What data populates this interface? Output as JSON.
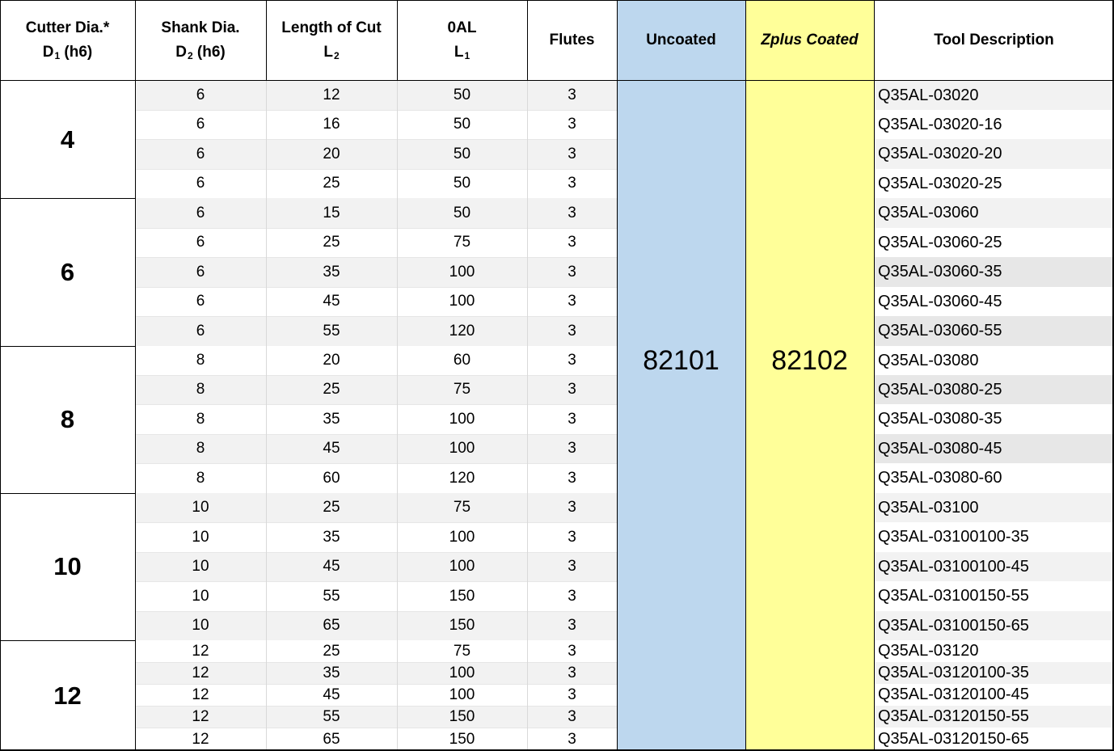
{
  "header": {
    "cutter_line1": "Cutter Dia.*",
    "cutter_line2": "D",
    "cutter_sub": "1",
    "cutter_tail": " (h6)",
    "shank_line1": "Shank Dia.",
    "shank_line2": "D",
    "shank_sub": "2",
    "shank_tail": " (h6)",
    "loc_line1": "Length of Cut",
    "loc_line2": "L",
    "loc_sub": "2",
    "oal_line1": "0AL",
    "oal_line2": "L",
    "oal_sub": "1",
    "flutes": "Flutes",
    "uncoated": "Uncoated",
    "coated": "Zplus Coated",
    "description": "Tool Description"
  },
  "codes": {
    "uncoated": "82101",
    "coated": "82102"
  },
  "colors": {
    "uncoated_bg": "#bdd7ee",
    "coated_bg": "#ffff99",
    "stripe_bg": "#f2f2f2",
    "stripe_desc_bg": "#e7e7e7",
    "grid": "#d9d9d9",
    "border": "#000000"
  },
  "groups": [
    {
      "diameter": "4",
      "rows": [
        {
          "shank": "6",
          "loc": "12",
          "oal": "50",
          "flutes": "3",
          "desc": "Q35AL-03020"
        },
        {
          "shank": "6",
          "loc": "16",
          "oal": "50",
          "flutes": "3",
          "desc": "Q35AL-03020-16"
        },
        {
          "shank": "6",
          "loc": "20",
          "oal": "50",
          "flutes": "3",
          "desc": "Q35AL-03020-20"
        },
        {
          "shank": "6",
          "loc": "25",
          "oal": "50",
          "flutes": "3",
          "desc": "Q35AL-03020-25"
        }
      ]
    },
    {
      "diameter": "6",
      "rows": [
        {
          "shank": "6",
          "loc": "15",
          "oal": "50",
          "flutes": "3",
          "desc": "Q35AL-03060"
        },
        {
          "shank": "6",
          "loc": "25",
          "oal": "75",
          "flutes": "3",
          "desc": "Q35AL-03060-25"
        },
        {
          "shank": "6",
          "loc": "35",
          "oal": "100",
          "flutes": "3",
          "desc": "Q35AL-03060-35"
        },
        {
          "shank": "6",
          "loc": "45",
          "oal": "100",
          "flutes": "3",
          "desc": "Q35AL-03060-45"
        },
        {
          "shank": "6",
          "loc": "55",
          "oal": "120",
          "flutes": "3",
          "desc": "Q35AL-03060-55"
        }
      ]
    },
    {
      "diameter": "8",
      "rows": [
        {
          "shank": "8",
          "loc": "20",
          "oal": "60",
          "flutes": "3",
          "desc": "Q35AL-03080"
        },
        {
          "shank": "8",
          "loc": "25",
          "oal": "75",
          "flutes": "3",
          "desc": "Q35AL-03080-25"
        },
        {
          "shank": "8",
          "loc": "35",
          "oal": "100",
          "flutes": "3",
          "desc": "Q35AL-03080-35"
        },
        {
          "shank": "8",
          "loc": "45",
          "oal": "100",
          "flutes": "3",
          "desc": "Q35AL-03080-45"
        },
        {
          "shank": "8",
          "loc": "60",
          "oal": "120",
          "flutes": "3",
          "desc": "Q35AL-03080-60"
        }
      ]
    },
    {
      "diameter": "10",
      "rows": [
        {
          "shank": "10",
          "loc": "25",
          "oal": "75",
          "flutes": "3",
          "desc": "Q35AL-03100"
        },
        {
          "shank": "10",
          "loc": "35",
          "oal": "100",
          "flutes": "3",
          "desc": "Q35AL-03100100-35"
        },
        {
          "shank": "10",
          "loc": "45",
          "oal": "100",
          "flutes": "3",
          "desc": "Q35AL-03100100-45"
        },
        {
          "shank": "10",
          "loc": "55",
          "oal": "150",
          "flutes": "3",
          "desc": "Q35AL-03100150-55"
        },
        {
          "shank": "10",
          "loc": "65",
          "oal": "150",
          "flutes": "3",
          "desc": "Q35AL-03100150-65"
        }
      ]
    },
    {
      "diameter": "12",
      "rows": [
        {
          "shank": "12",
          "loc": "25",
          "oal": "75",
          "flutes": "3",
          "desc": "Q35AL-03120"
        },
        {
          "shank": "12",
          "loc": "35",
          "oal": "100",
          "flutes": "3",
          "desc": "Q35AL-03120100-35"
        },
        {
          "shank": "12",
          "loc": "45",
          "oal": "100",
          "flutes": "3",
          "desc": "Q35AL-03120100-45"
        },
        {
          "shank": "12",
          "loc": "55",
          "oal": "150",
          "flutes": "3",
          "desc": "Q35AL-03120150-55"
        },
        {
          "shank": "12",
          "loc": "65",
          "oal": "150",
          "flutes": "3",
          "desc": "Q35AL-03120150-65"
        }
      ]
    }
  ]
}
